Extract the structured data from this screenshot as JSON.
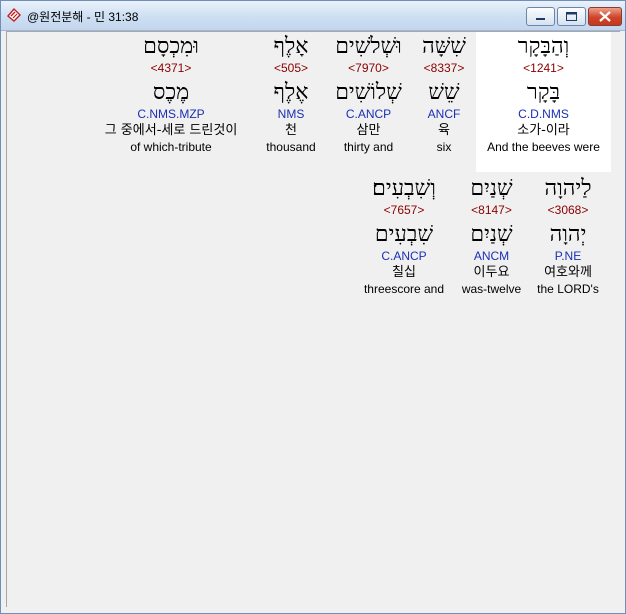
{
  "window": {
    "title": "@원전분해 - 민 31:38",
    "controls": {
      "minimize_icon": "minimize-icon",
      "maximize_icon": "maximize-icon",
      "close_icon": "close-icon"
    }
  },
  "rows": [
    [
      {
        "hebrew": "וְהַבָּקָר",
        "strong": "<1241>",
        "lemma": "בָּקָר",
        "morph": "C.D.NMS",
        "korean": "소가-이라",
        "english": "And the beeves were",
        "highlight": true
      },
      {
        "hebrew": "שִׁשָּׁה",
        "strong": "<8337>",
        "lemma": "שֵׁשׁ",
        "morph": "ANCF",
        "korean": "육",
        "english": "six",
        "highlight": false
      },
      {
        "hebrew": "וּשְׁלֹשִׁים",
        "strong": "<7970>",
        "lemma": "שְׁלוֹשִׁים",
        "morph": "C.ANCP",
        "korean": "삼만",
        "english": "thirty and",
        "highlight": false
      },
      {
        "hebrew": "אָלֶף",
        "strong": "<505>",
        "lemma": "אֶלֶף",
        "morph": "NMS",
        "korean": "천",
        "english": "thousand",
        "highlight": false
      },
      {
        "hebrew": "וּמִכְסָם",
        "strong": "<4371>",
        "lemma": "מֶכֶס",
        "morph": "C.NMS.MZP",
        "korean": "그 중에서-세로 드린것이",
        "english": "of which-tribute",
        "highlight": false
      }
    ],
    [
      {
        "hebrew": "לַיהוָה",
        "strong": "<3068>",
        "lemma": "יְהוָה",
        "morph": "P.NE",
        "korean": "여호와께",
        "english": "the LORD's",
        "highlight": false
      },
      {
        "hebrew": "שְׁנַיִם",
        "strong": "<8147>",
        "lemma": "שְׁנַיִם",
        "morph": "ANCM",
        "korean": "이두요",
        "english": "was-twelve",
        "highlight": false
      },
      {
        "hebrew": "וְשִׁבְעִים׃",
        "strong": "<7657>",
        "lemma": "שִׁבְעִים",
        "morph": "C.ANCP",
        "korean": "칠십",
        "english": "threescore and",
        "highlight": false
      }
    ]
  ]
}
